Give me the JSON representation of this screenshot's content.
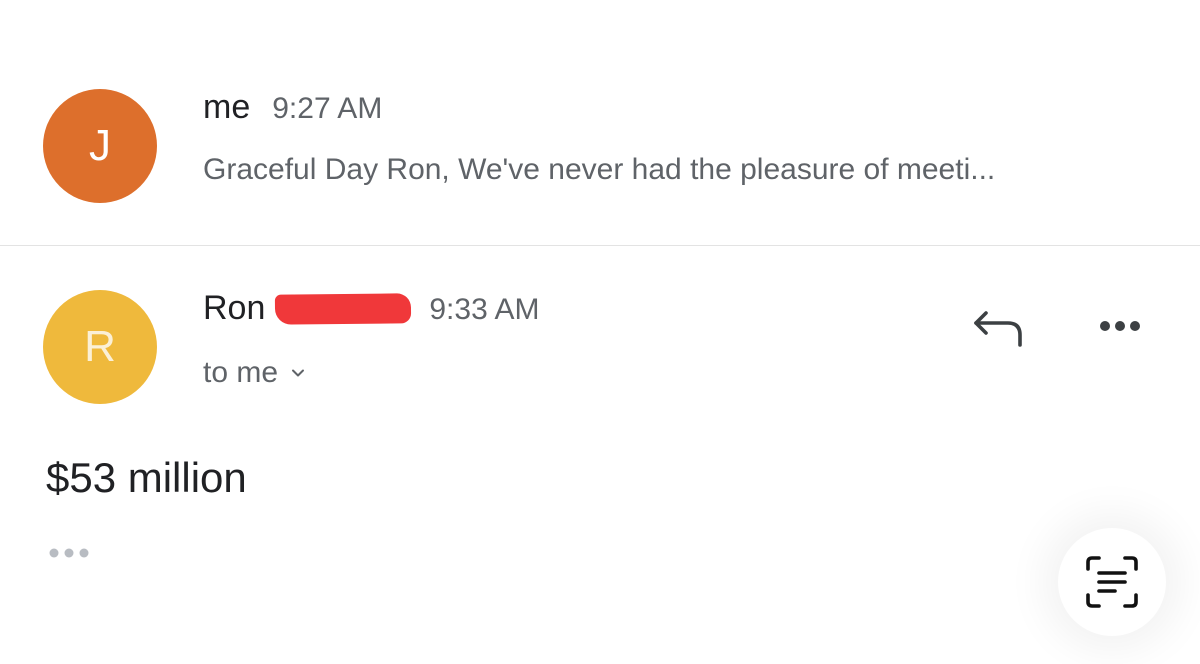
{
  "thread": {
    "messages": [
      {
        "avatar_letter": "J",
        "avatar_color": "#dd6f2c",
        "sender": "me",
        "time": "9:27 AM",
        "snippet": "Graceful Day Ron, We've never had the pleasure of meeti..."
      },
      {
        "avatar_letter": "R",
        "avatar_color": "#efb93c",
        "sender": "Ron",
        "time": "9:33 AM",
        "recipient": "to me",
        "body": "$53 million"
      }
    ]
  },
  "icons": {
    "reply": "reply-arrow-icon",
    "more": "more-horizontal-icon",
    "trimmed": "ellipsis-icon",
    "live_text": "live-text-scan-icon"
  },
  "colors": {
    "redaction": "#f0383a",
    "divider": "#e3e3e3"
  }
}
